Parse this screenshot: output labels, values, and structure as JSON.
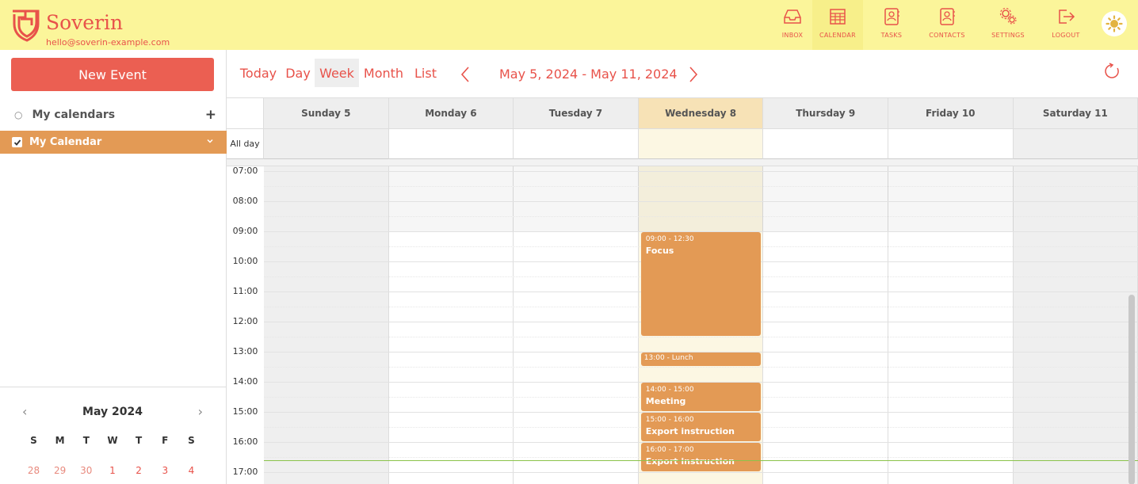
{
  "app": {
    "brand": "Soverin",
    "email": "hello@soverin-example.com",
    "accent": "#e8524a",
    "header_bg": "#fbf59a",
    "event_color": "#e39a55"
  },
  "nav": [
    {
      "label": "INBOX",
      "icon": "inbox-icon"
    },
    {
      "label": "CALENDAR",
      "icon": "calendar-icon"
    },
    {
      "label": "TASKS",
      "icon": "tasks-icon"
    },
    {
      "label": "CONTACTS",
      "icon": "contacts-icon"
    },
    {
      "label": "SETTINGS",
      "icon": "settings-icon"
    },
    {
      "label": "LOGOUT",
      "icon": "logout-icon"
    }
  ],
  "sidebar": {
    "new_event": "New Event",
    "calendars_title": "My calendars",
    "calendar_item": "My Calendar",
    "mini": {
      "title": "May 2024",
      "dow": [
        "S",
        "M",
        "T",
        "W",
        "T",
        "F",
        "S"
      ],
      "days": [
        {
          "d": "28",
          "kind": "prev"
        },
        {
          "d": "29",
          "kind": "prev"
        },
        {
          "d": "30",
          "kind": "prev"
        },
        {
          "d": "1",
          "kind": "cur"
        },
        {
          "d": "2",
          "kind": "cur"
        },
        {
          "d": "3",
          "kind": "cur"
        },
        {
          "d": "4",
          "kind": "cur"
        }
      ]
    }
  },
  "toolbar": {
    "today": "Today",
    "day": "Day",
    "week": "Week",
    "month": "Month",
    "list": "List",
    "range": "May 5, 2024 - May 11, 2024"
  },
  "grid": {
    "allday_label": "All day",
    "days": [
      "Sunday 5",
      "Monday 6",
      "Tuesday 7",
      "Wednesday 8",
      "Thursday 9",
      "Friday 10",
      "Saturday 11"
    ],
    "today_index": 3,
    "hours": [
      "07:00",
      "08:00",
      "09:00",
      "10:00",
      "11:00",
      "12:00",
      "13:00",
      "14:00",
      "15:00",
      "16:00",
      "17:00"
    ],
    "now": "16:36",
    "events": [
      {
        "day": 3,
        "start": "09:00",
        "end": "12:30",
        "time": "09:00 - 12:30",
        "title": "Focus"
      },
      {
        "day": 3,
        "start": "13:00",
        "end": "13:30",
        "time": "13:00 - Lunch",
        "title": ""
      },
      {
        "day": 3,
        "start": "14:00",
        "end": "15:00",
        "time": "14:00 - 15:00",
        "title": "Meeting"
      },
      {
        "day": 3,
        "start": "15:00",
        "end": "16:00",
        "time": "15:00 - 16:00",
        "title": "Export instruction"
      },
      {
        "day": 3,
        "start": "16:00",
        "end": "17:00",
        "time": "16:00 - 17:00",
        "title": "Export instruction"
      }
    ]
  }
}
